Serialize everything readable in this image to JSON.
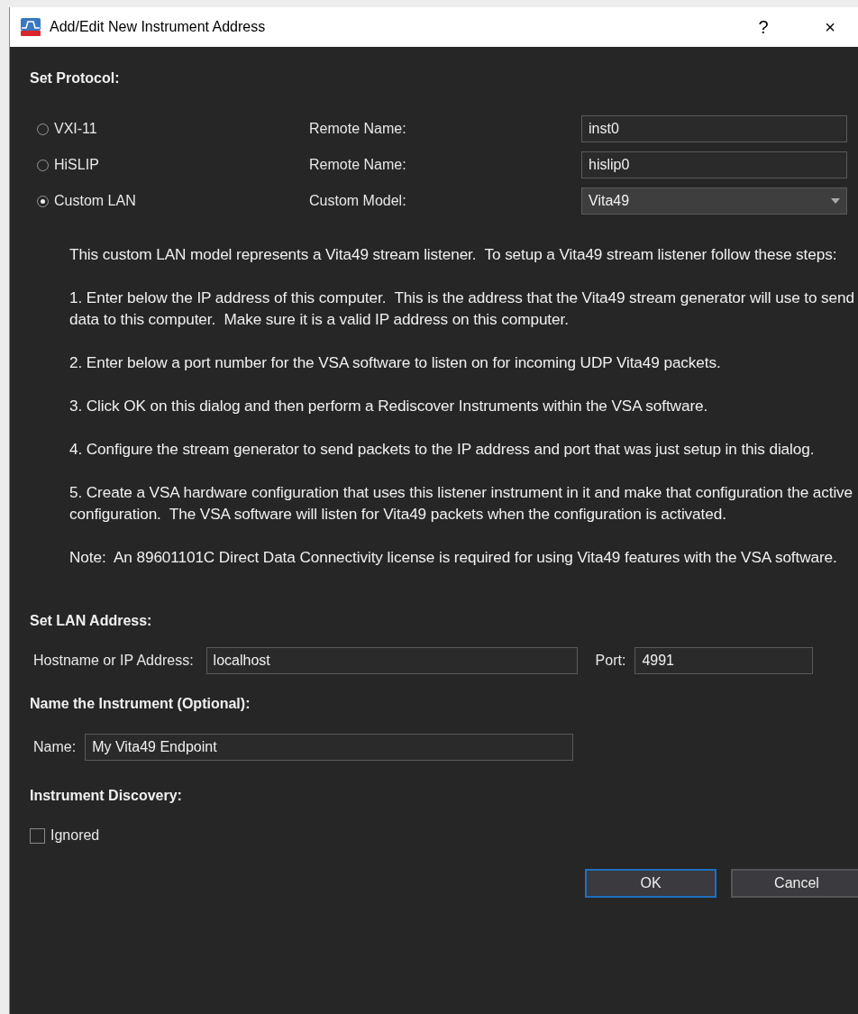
{
  "window": {
    "title": "Add/Edit New Instrument Address",
    "help": "?",
    "close": "×"
  },
  "protocol": {
    "heading": "Set Protocol:",
    "options": [
      {
        "label": "VXI-11",
        "selected": false,
        "field_label": "Remote Name:",
        "kind": "text",
        "value": "inst0"
      },
      {
        "label": "HiSLIP",
        "selected": false,
        "field_label": "Remote Name:",
        "kind": "text",
        "value": "hislip0"
      },
      {
        "label": "Custom LAN",
        "selected": true,
        "field_label": "Custom Model:",
        "kind": "dropdown",
        "value": "Vita49"
      }
    ],
    "description": [
      "This custom LAN model represents a Vita49 stream listener.  To setup a Vita49 stream listener follow these steps:",
      "1. Enter below the IP address of this computer.  This is the address that the Vita49 stream generator will use to send data to this computer.  Make sure it is a valid IP address on this computer.",
      "2. Enter below a port number for the VSA software to listen on for incoming UDP Vita49 packets.",
      "3. Click OK on this dialog and then perform a Rediscover Instruments within the VSA software.",
      "4. Configure the stream generator to send packets to the IP address and port that was just setup in this dialog.",
      "5. Create a VSA hardware configuration that uses this listener instrument in it and make that configuration the active configuration.  The VSA software will listen for Vita49 packets when the configuration is activated.",
      "Note:  An 89601101C Direct Data Connectivity license is required for using Vita49 features with the VSA software."
    ]
  },
  "lan": {
    "heading": "Set LAN Address:",
    "host_label": "Hostname or IP Address:",
    "host": "localhost",
    "port_label": "Port:",
    "port": "4991"
  },
  "name": {
    "heading": "Name the Instrument (Optional):",
    "label": "Name:",
    "value": "My Vita49 Endpoint"
  },
  "discovery": {
    "heading": "Instrument Discovery:",
    "label": "Ignored",
    "checked": false
  },
  "buttons": [
    {
      "label": "OK",
      "default": true
    },
    {
      "label": "Cancel",
      "default": false
    }
  ]
}
